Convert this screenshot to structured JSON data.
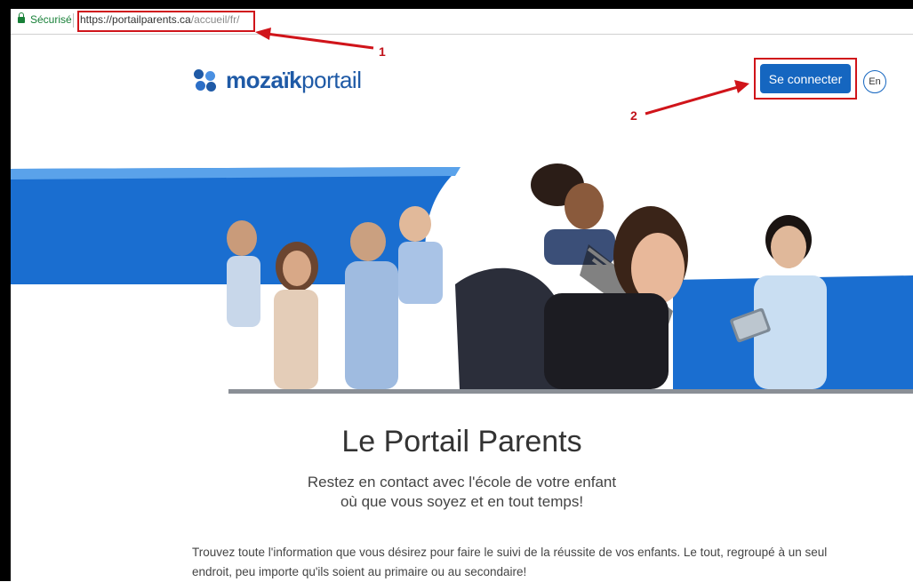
{
  "browser": {
    "secure_label": "Sécurisé",
    "url_host": "https://portailparents.ca",
    "url_path": "/accueil/fr/"
  },
  "annotations": {
    "callout_1": "1",
    "callout_2": "2"
  },
  "header": {
    "logo_bold": "mozaïk",
    "logo_light": "portail",
    "login_label": "Se connecter",
    "lang_label": "En"
  },
  "main": {
    "title": "Le Portail Parents",
    "subtitle_line1": "Restez en contact avec l'école de votre enfant",
    "subtitle_line2": "où que vous soyez et en tout temps!",
    "body_line1": "Trouvez toute l'information que vous désirez pour faire le suivi de la réussite de vos enfants. Le tout, regroupé à un seul",
    "body_line2": "endroit, peu importe qu'ils soient au primaire ou au secondaire!"
  },
  "colors": {
    "brand_blue": "#1566c0",
    "annotation_red": "#d0141a",
    "secure_green": "#188038"
  }
}
